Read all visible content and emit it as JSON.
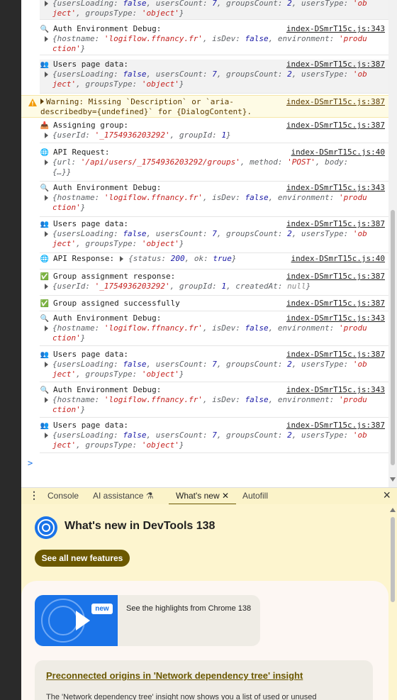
{
  "console": {
    "entries": [
      {
        "icon": "",
        "label": "",
        "source": "",
        "obj": "{usersLoading: false, usersCount: 7, groupsCount: 2, usersType: 'object', groupsType: 'object'}"
      },
      {
        "icon": "search-icon",
        "label": "Auth Environment Debug:",
        "source": "index-DSmrT15c.js:343",
        "obj": "{hostname: 'logiflow.ffnancy.fr', isDev: false, environment: 'production'}"
      },
      {
        "icon": "users-icon",
        "label": "Users page data:",
        "source": "index-DSmrT15c.js:387",
        "obj": "{usersLoading: false, usersCount: 7, groupsCount: 2, usersType: 'object', groupsType: 'object'}"
      },
      {
        "icon": "inbox-icon",
        "label": "Assigning group:",
        "source": "index-DSmrT15c.js:387",
        "obj": "{userId: '_1754936203292', groupId: 1}"
      },
      {
        "icon": "globe-icon",
        "label": "API Request:",
        "source": "index-DSmrT15c.js:40",
        "obj": "{url: '/api/users/_1754936203292/groups', method: 'POST', body: {…}}"
      },
      {
        "icon": "search-icon",
        "label": "Auth Environment Debug:",
        "source": "index-DSmrT15c.js:343",
        "obj": "{hostname: 'logiflow.ffnancy.fr', isDev: false, environment: 'production'}"
      },
      {
        "icon": "users-icon",
        "label": "Users page data:",
        "source": "index-DSmrT15c.js:387",
        "obj": "{usersLoading: false, usersCount: 7, groupsCount: 2, usersType: 'object', groupsType: 'object'}"
      },
      {
        "icon": "globe-icon",
        "label": "API Response:",
        "source": "index-DSmrT15c.js:40",
        "obj": "{status: 200, ok: true}"
      },
      {
        "icon": "check-icon",
        "label": "Group assignment response:",
        "source": "index-DSmrT15c.js:387",
        "obj": "{userId: '_1754936203292', groupId: 1, createdAt: null}"
      },
      {
        "icon": "check-icon",
        "label": "Group assigned successfully",
        "source": "index-DSmrT15c.js:387",
        "obj": ""
      },
      {
        "icon": "search-icon",
        "label": "Auth Environment Debug:",
        "source": "index-DSmrT15c.js:343",
        "obj": "{hostname: 'logiflow.ffnancy.fr', isDev: false, environment: 'production'}"
      },
      {
        "icon": "users-icon",
        "label": "Users page data:",
        "source": "index-DSmrT15c.js:387",
        "obj": "{usersLoading: false, usersCount: 7, groupsCount: 2, usersType: 'object', groupsType: 'object'}"
      },
      {
        "icon": "search-icon",
        "label": "Auth Environment Debug:",
        "source": "index-DSmrT15c.js:343",
        "obj": "{hostname: 'logiflow.ffnancy.fr', isDev: false, environment: 'production'}"
      },
      {
        "icon": "users-icon",
        "label": "Users page data:",
        "source": "index-DSmrT15c.js:387",
        "obj": "{usersLoading: false, usersCount: 7, groupsCount: 2, usersType: 'object', groupsType: 'object'}"
      }
    ],
    "warning": {
      "text": "Warning: Missing `Description` or `aria-describedby={undefined}` for {DialogContent}.",
      "source": "index-DSmrT15c.js:387"
    },
    "prompt": ">"
  },
  "drawer": {
    "tabs": [
      {
        "label": "Console"
      },
      {
        "label": "AI assistance"
      },
      {
        "label": "What's new"
      },
      {
        "label": "Autofill"
      }
    ]
  },
  "whats_new": {
    "title": "What's new in DevTools 138",
    "see_all_label": "See all new features",
    "highlight_badge": "new",
    "highlight_text": "See the highlights from Chrome 138",
    "feature_title": "Preconnected origins in 'Network dependency tree' insight",
    "feature_text": "The 'Network dependency tree' insight now shows you a list of used or unused"
  },
  "colors": {
    "accent_olive": "#6b5800",
    "warning_bg": "#fefbe5",
    "string_red": "#c5221f",
    "keyword_blue": "#1a1aa6",
    "drawer_bg": "#fdf5cf"
  }
}
